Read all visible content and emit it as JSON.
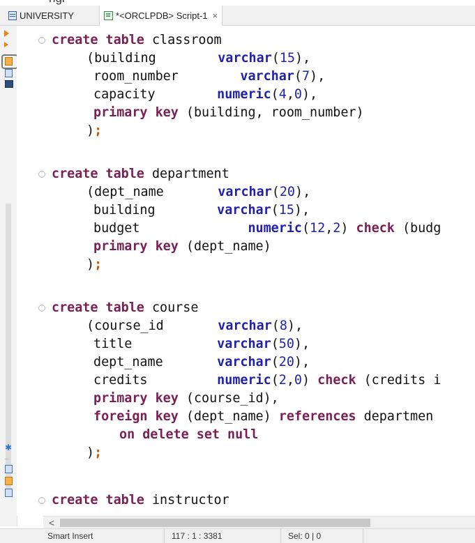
{
  "window": {
    "top_cut_text": "ngi"
  },
  "tabs": [
    {
      "label": "UNIVERSITY",
      "icon": "database-icon",
      "active": false
    },
    {
      "label": "*<ORCLPDB> Script-1",
      "icon": "sql-script-icon",
      "active": true,
      "close": "×"
    }
  ],
  "toolbar": {
    "items": [
      "execute-statement-icon",
      "execute-script-icon",
      "explain-plan-icon",
      "history-icon",
      "terminal-icon",
      "settings-icon",
      "more-icon",
      "export-icon",
      "new-script-icon",
      "save-icon"
    ]
  },
  "editor": {
    "tokens": {
      "create": "create",
      "table": "table",
      "primary": "primary",
      "key": "key",
      "foreign": "foreign",
      "references": "references",
      "on": "on",
      "delete": "delete",
      "set": "set",
      "null": "null",
      "check": "check",
      "varchar": "varchar",
      "numeric": "numeric"
    },
    "tables": {
      "classroom": "classroom",
      "department": "department",
      "course": "course",
      "instructor": "instructor"
    },
    "columns": {
      "building": "building",
      "room_number": "room_number",
      "capacity": "capacity",
      "dept_name": "dept_name",
      "budget": "budget",
      "course_id": "course_id",
      "title": "title",
      "credits": "credits"
    },
    "text_fragments": {
      "classroom_pk_cols": "(building, room_number)",
      "budget_check": "(budg",
      "department_pk_cols": "(dept_name)",
      "course_pk_cols": "(course_id),",
      "course_fk_cols": "(dept_name)",
      "department_cut": "departmen",
      "credits_check": "(credits",
      "credits_check_cut": "i"
    },
    "numbers": {
      "n15": "15",
      "n7": "7",
      "n4": "4",
      "n0": "0",
      "n20": "20",
      "n12": "12",
      "n2": "2",
      "n8": "8",
      "n50": "50"
    }
  },
  "scrollbar": {
    "left_arrow": "<"
  },
  "statusbar": {
    "mode": "Smart Insert",
    "position": "117 : 1 : 3381",
    "selection": "Sel: 0 | 0"
  }
}
